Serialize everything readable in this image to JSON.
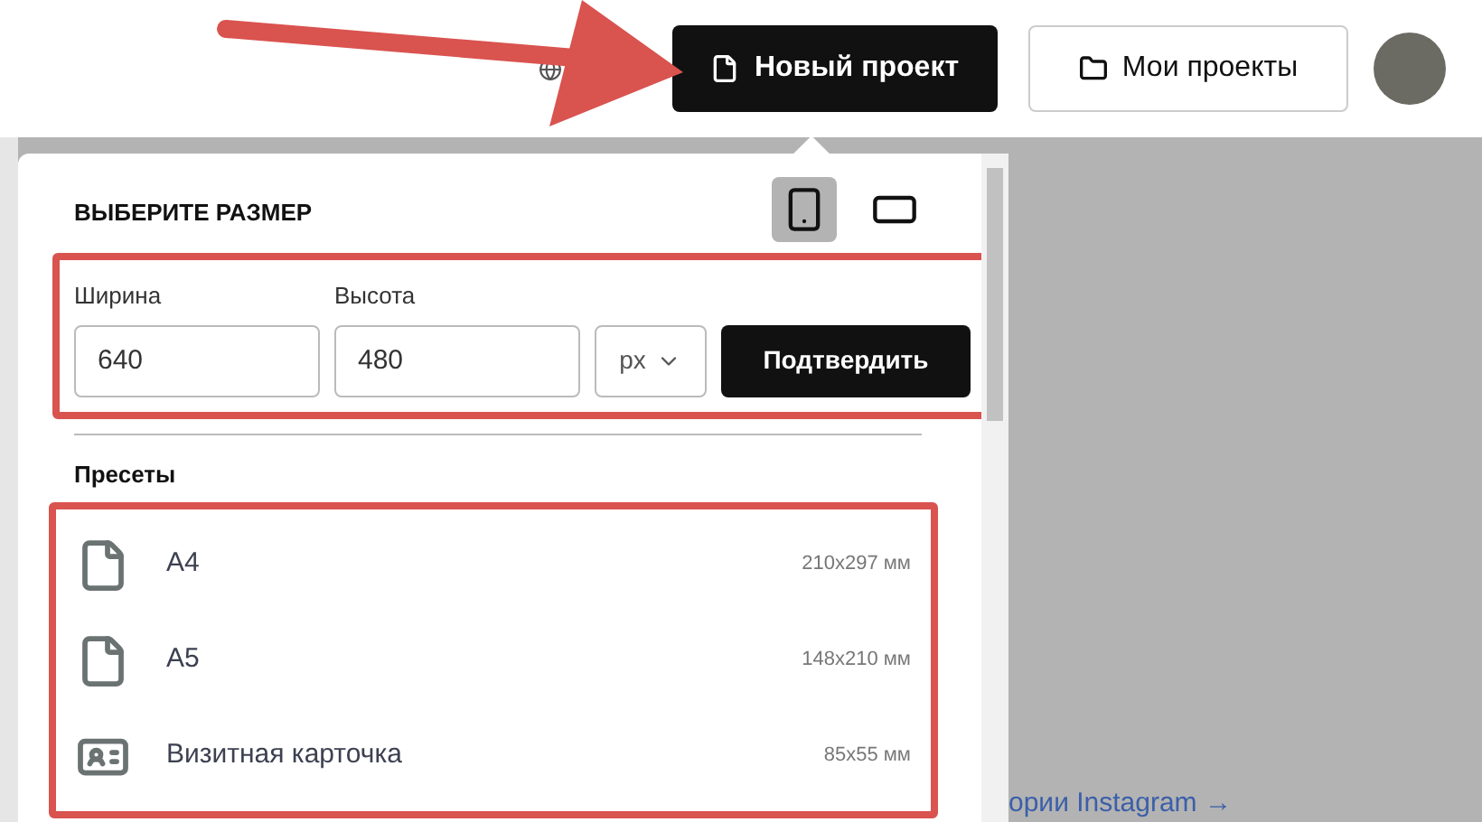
{
  "header": {
    "new_project_button": "Новый проект",
    "my_projects_button": "Мои проекты"
  },
  "background": {
    "instagram_link": "ории Instagram →"
  },
  "size_dialog": {
    "title": "ВЫБЕРИТЕ РАЗМЕР",
    "orientations": [
      {
        "kind": "portrait",
        "selected": true
      },
      {
        "kind": "landscape",
        "selected": false
      }
    ],
    "width": {
      "label": "Ширина",
      "value": "640"
    },
    "height": {
      "label": "Высота",
      "value": "480"
    },
    "unit": "px",
    "confirm_button": "Подтвердить",
    "presets_title": "Пресеты",
    "presets": [
      {
        "kind": "document",
        "name": "А4",
        "size": "210x297 мм"
      },
      {
        "kind": "document",
        "name": "А5",
        "size": "148x210 мм"
      },
      {
        "kind": "card",
        "name": "Визитная карточка",
        "size": "85x55 мм"
      }
    ]
  }
}
